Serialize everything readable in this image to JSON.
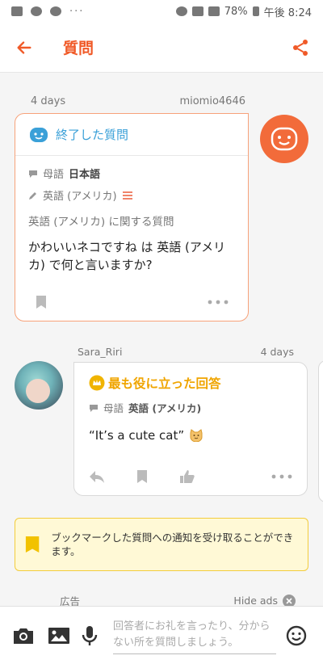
{
  "status_bar": {
    "left_icons": [
      "image-icon",
      "mail-icon",
      "notification-icon"
    ],
    "more": "···",
    "battery": "78%",
    "time": "午後 8:24"
  },
  "header": {
    "title": "質問"
  },
  "question": {
    "time_ago": "4 days",
    "username": "miomio4646",
    "status_label": "終了した質問",
    "native_label": "母語",
    "native_language": "日本語",
    "target_language": "英語 (アメリカ)",
    "about": "英語 (アメリカ) に関する質問",
    "text": "かわいいネコですね は 英語 (アメリカ) で何と言いますか?"
  },
  "answer": {
    "username": "Sara_Riri",
    "time_ago": "4 days",
    "best_label": "最も役に立った回答",
    "native_label": "母語",
    "native_language": "英語 (アメリカ)",
    "text": "“It’s a cute cat”"
  },
  "notice": {
    "text": "ブックマークした質問への通知を受け取ることができます。"
  },
  "ad": {
    "label": "広告",
    "hide_label": "Hide ads"
  },
  "composer": {
    "placeholder": "回答者にお礼を言ったり、分からない所を質問しましょう。"
  },
  "colors": {
    "accent": "#f05a28",
    "finished_blue": "#3aa0d8",
    "best_gold": "#f0a500",
    "notice_bg": "#fff9d6"
  }
}
